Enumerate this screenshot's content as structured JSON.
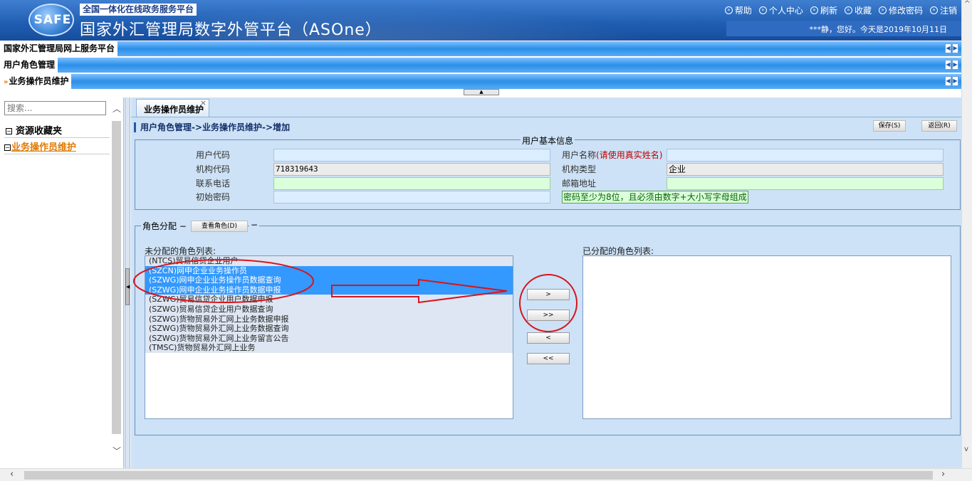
{
  "header": {
    "logo_text": "SAFE",
    "sub_title": "全国一体化在线政务服务平台",
    "main_title": "国家外汇管理局数字外管平台（ASOne）",
    "links": [
      "帮助",
      "个人中心",
      "刷新",
      "收藏",
      "修改密码",
      "注销"
    ],
    "greeting": "***静，您好。今天是2019年10月11日"
  },
  "bars": {
    "portal": "国家外汇管理局网上服务平台",
    "module": "用户角色管理",
    "page": "业务操作员维护"
  },
  "sidebar": {
    "search_placeholder": "搜索...",
    "items": [
      {
        "toggle": "−",
        "label": "资源收藏夹"
      },
      {
        "toggle": "−",
        "label": "业务操作员维护"
      }
    ]
  },
  "content": {
    "tab_label": "业务操作员维护",
    "tab_close": "×",
    "breadcrumb": "用户角色管理->业务操作员维护->增加",
    "save_label": "保存(S)",
    "back_label": "返回(R)",
    "basic_info": {
      "legend": "用户基本信息",
      "user_code_label": "用户代码",
      "user_code": "",
      "user_name_label": "用户名称",
      "user_name_note": "(请使用真实姓名)",
      "user_name": "",
      "org_code_label": "机构代码",
      "org_code": "718319643",
      "org_type_label": "机构类型",
      "org_type": "企业",
      "phone_label": "联系电话",
      "phone": "",
      "email_label": "邮箱地址",
      "email": "",
      "init_pwd_label": "初始密码",
      "init_pwd": "",
      "pwd_hint": "密码至少为8位，且必须由数字+大小写字母组成"
    },
    "roles": {
      "legend": "角色分配",
      "view_button": "查看角色(D)",
      "unassigned_label": "未分配的角色列表:",
      "assigned_label": "已分配的角色列表:",
      "unassigned": [
        {
          "text": "(NTCS)贸易信贷企业用户",
          "selected": false
        },
        {
          "text": "(SZCN)网申企业业务操作员",
          "selected": true
        },
        {
          "text": "(SZWG)网申企业业务操作员数据查询",
          "selected": true
        },
        {
          "text": "(SZWG)网申企业业务操作员数据申报",
          "selected": true
        },
        {
          "text": "(SZWG)贸易信贷企业用户数据申报",
          "selected": false
        },
        {
          "text": "(SZWG)贸易信贷企业用户数据查询",
          "selected": false
        },
        {
          "text": "(SZWG)货物贸易外汇网上业务数据申报",
          "selected": false
        },
        {
          "text": "(SZWG)货物贸易外汇网上业务数据查询",
          "selected": false
        },
        {
          "text": "(SZWG)货物贸易外汇网上业务留言公告",
          "selected": false
        },
        {
          "text": "(TMSC)货物贸易外汇网上业务",
          "selected": false
        }
      ],
      "assigned": [],
      "move_buttons": [
        ">",
        ">>",
        "<",
        "<<"
      ]
    }
  },
  "annotation_color": "#d9141c",
  "accent_color": "#1f5cb0"
}
